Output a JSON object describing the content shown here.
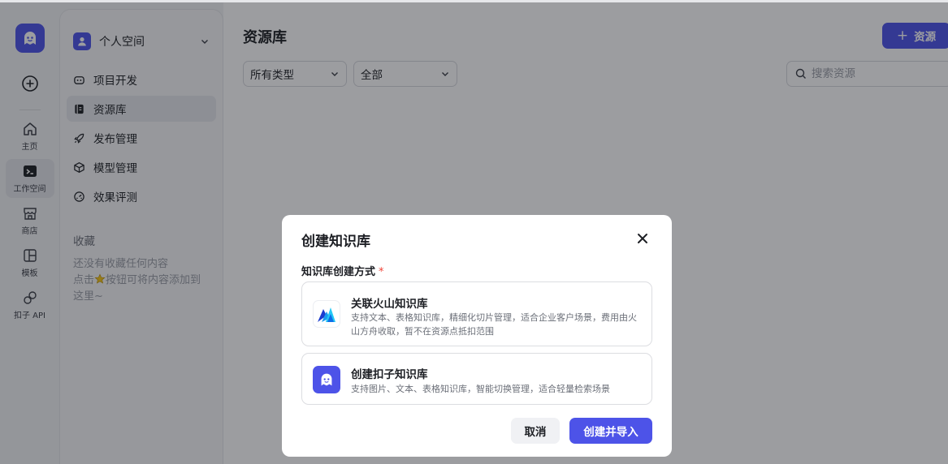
{
  "rail": {
    "items": [
      {
        "label": "主页",
        "icon": "home-icon"
      },
      {
        "label": "工作空间",
        "icon": "terminal-icon"
      },
      {
        "label": "商店",
        "icon": "store-icon"
      },
      {
        "label": "模板",
        "icon": "template-icon"
      },
      {
        "label": "扣子 API",
        "icon": "api-link-icon"
      }
    ]
  },
  "sidebar": {
    "space_name": "个人空间",
    "nav": [
      {
        "label": "项目开发",
        "icon": "robot-icon"
      },
      {
        "label": "资源库",
        "icon": "library-icon"
      },
      {
        "label": "发布管理",
        "icon": "rocket-icon"
      },
      {
        "label": "模型管理",
        "icon": "cube-icon"
      },
      {
        "label": "效果评测",
        "icon": "gauge-icon"
      }
    ],
    "favorites_title": "收藏",
    "favorites_empty_1": "还没有收藏任何内容",
    "favorites_empty_2a": "点击",
    "favorites_empty_2b": "按钮可将内容添加到",
    "favorites_empty_3": "这里~"
  },
  "main": {
    "title": "资源库",
    "add_button": "资源",
    "filter_type": "所有类型",
    "filter_scope": "全部",
    "search_placeholder": "搜索资源"
  },
  "modal": {
    "title": "创建知识库",
    "field_label": "知识库创建方式",
    "required_mark": "*",
    "options": [
      {
        "title": "关联火山知识库",
        "desc": "支持文本、表格知识库，精细化切片管理，适合企业客户场景，费用由火山方舟收取，暂不在资源点抵扣范围"
      },
      {
        "title": "创建扣子知识库",
        "desc": "支持图片、文本、表格知识库，智能切换管理，适合轻量检索场景"
      }
    ],
    "cancel": "取消",
    "confirm": "创建并导入"
  },
  "colors": {
    "accent": "#4d53e8",
    "required": "#f04438",
    "overlay": "rgba(20,22,28,0.42)"
  }
}
